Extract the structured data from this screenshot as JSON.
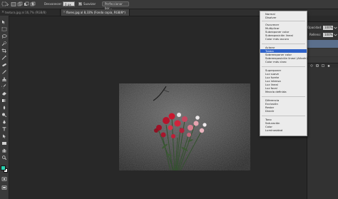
{
  "options_bar": {
    "feather_label": "Desvanecer:",
    "feather_value": "0 px",
    "smooth_label": "Suavizar",
    "refine_edge_label": "Perfeccionar bor..."
  },
  "tabs": [
    {
      "label": "textura.jpg al 16,7% (RGB/8)",
      "active": false
    },
    {
      "label": "flores.jpg al 8,33% (Fondo copia, RGB/8*)",
      "active": true
    }
  ],
  "right_panel": {
    "opacity_label": "Opacidad:",
    "opacity_value": "100%",
    "fill_label": "Relleno:",
    "fill_value": "100%"
  },
  "blend_menu": {
    "groups": [
      [
        "Normal",
        "Disolver"
      ],
      [
        "Oscurecer",
        "Multiplicar",
        "Subexponer color",
        "Subexposición lineal",
        "Color más oscuro"
      ],
      [
        "Aclarar",
        "Trama",
        "Sobreexponer color",
        "Sobreexposición lineal (Añadir)",
        "Color más claro"
      ],
      [
        "Superponer",
        "Luz suave",
        "Luz fuerte",
        "Luz intensa",
        "Luz lineal",
        "Luz focal",
        "Mezcla definida"
      ],
      [
        "Diferencia",
        "Exclusión",
        "Restar",
        "Dividir"
      ],
      [
        "Tono",
        "Saturación",
        "Color",
        "Luminosidad"
      ]
    ],
    "selected": "Trama"
  },
  "colors": {
    "menu_highlight": "#2f62c9",
    "foreground_swatch": "#2bd1b0",
    "background_swatch": "#ffffff"
  },
  "icons": [
    "marquee-tool-icon",
    "move-tool-icon",
    "lasso-tool-icon",
    "crop-tool-icon",
    "brush-tool-icon",
    "text-tool-icon",
    "hand-tool-icon",
    "zoom-tool-icon"
  ]
}
